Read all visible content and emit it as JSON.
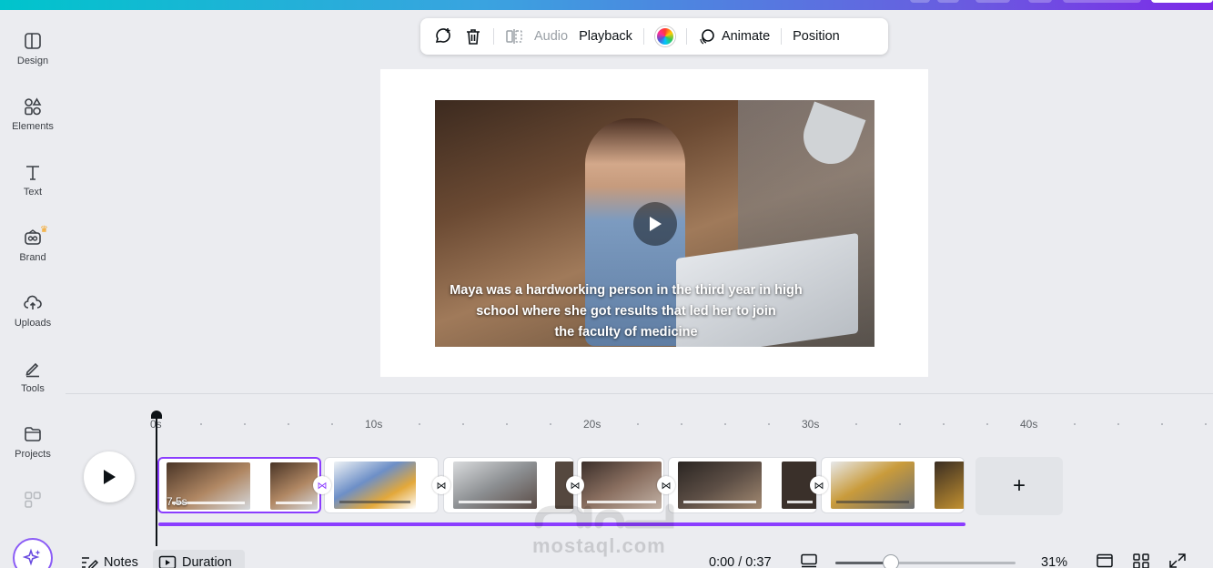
{
  "sidebar": {
    "items": [
      {
        "label": "Design",
        "icon": "design-icon"
      },
      {
        "label": "Elements",
        "icon": "elements-icon"
      },
      {
        "label": "Text",
        "icon": "text-icon"
      },
      {
        "label": "Brand",
        "icon": "brand-icon"
      },
      {
        "label": "Uploads",
        "icon": "uploads-icon"
      },
      {
        "label": "Tools",
        "icon": "tools-icon"
      },
      {
        "label": "Projects",
        "icon": "projects-icon"
      }
    ]
  },
  "toolbar": {
    "audio_label": "Audio",
    "playback_label": "Playback",
    "animate_label": "Animate",
    "position_label": "Position"
  },
  "canvas": {
    "caption_line1": "Maya was a hardworking person in the third year in high",
    "caption_line2": "school where she got results that led her to join",
    "caption_line3": "the faculty of medicine"
  },
  "timeline": {
    "ruler": [
      "0s",
      "10s",
      "20s",
      "30s",
      "40s"
    ],
    "first_clip_duration": "7.5s",
    "audio_track_color": "#8b3dff",
    "add_label": "+"
  },
  "watermark": {
    "text": "mostaql.com"
  },
  "bottom_bar": {
    "notes_label": "Notes",
    "duration_label": "Duration",
    "time": "0:00 / 0:37",
    "zoom_value": 0.31,
    "zoom_label": "31%"
  },
  "colors": {
    "accent": "#8b3dff",
    "background": "#ebecf0"
  }
}
